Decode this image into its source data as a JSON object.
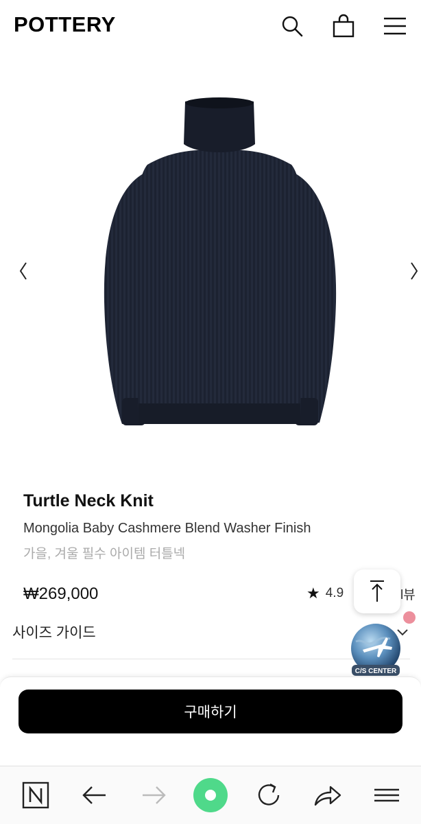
{
  "header": {
    "logo": "POTTERY",
    "icons": [
      "search-icon",
      "shopping-bag-icon",
      "hamburger-menu-icon"
    ]
  },
  "gallery": {
    "prev_icon": "chevron-left-icon",
    "next_icon": "chevron-right-icon",
    "image": "navy turtleneck knit sweater"
  },
  "product": {
    "title": "Turtle Neck Knit",
    "subtitle": "Mongolia Baby Cashmere Blend Washer Finish",
    "tagline": "가을, 겨울 필수 아이템 터틀넥",
    "price": "₩269,000",
    "rating": "4.9",
    "review_fragment": "l뷰"
  },
  "size_guide": {
    "label": "사이즈 가이드"
  },
  "floating": {
    "cs_label": "C/S CENTER"
  },
  "purchase": {
    "button_label": "구매하기"
  },
  "browser_bar": {
    "icons": [
      "naver-n-icon",
      "back-arrow-icon",
      "forward-arrow-icon",
      "home-circle-icon",
      "reload-icon",
      "share-icon",
      "menu-icon"
    ]
  },
  "colors": {
    "accent_green": "#4fd98a",
    "button_black": "#000000",
    "sweater_navy": "#1b2130"
  }
}
